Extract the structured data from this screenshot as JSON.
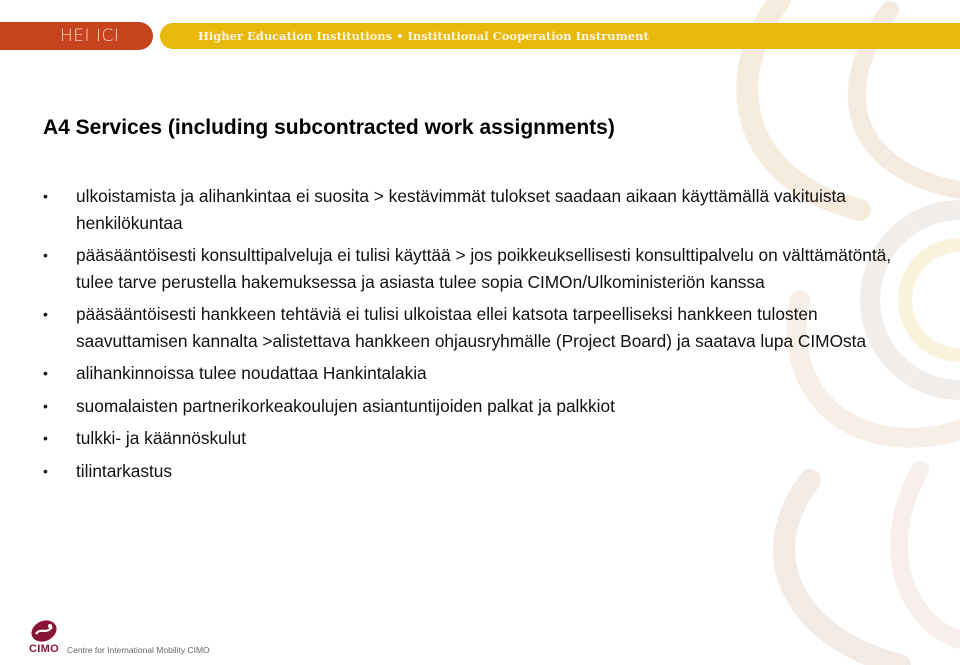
{
  "header": {
    "logo_text": "HEI ICI",
    "tagline": "Higher Education Institutions • Institutional Cooperation Instrument",
    "colors": {
      "logo_bg": "#c8441f",
      "tagline_bg": "#e8b80a"
    }
  },
  "slide": {
    "title": "A4 Services (including subcontracted work assignments)",
    "bullets": [
      {
        "text": "ulkoistamista ja alihankintaa ei suosita > kestävimmät tulokset saadaan aikaan käyttämällä vakituista henkilökuntaa"
      },
      {
        "text": "pääsääntöisesti konsulttipalveluja ei tulisi käyttää > jos poikkeuksellisesti konsulttipalvelu on välttämätöntä, tulee tarve perustella hakemuksessa ja asiasta tulee sopia CIMOn/Ulkoministeriön kanssa"
      },
      {
        "text": "pääsääntöisesti hankkeen tehtäviä ei tulisi ulkoistaa ellei katsota tarpeelliseksi hankkeen tulosten saavuttamisen kannalta >alistettava hankkeen ohjausryhmälle (Project Board) ja saatava lupa CIMOsta"
      },
      {
        "text": "alihankinnoissa tulee noudattaa Hankintalakia"
      },
      {
        "text": "suomalaisten partnerikorkeakoulujen asiantuntijoiden palkat ja palkkiot"
      },
      {
        "text": "tulkki- ja käännöskulut"
      },
      {
        "text": "tilintarkastus"
      }
    ],
    "bullet_glyph": "•"
  },
  "footer": {
    "logo_text": "CIMO",
    "org_name": "Centre for International Mobility CIMO",
    "brand_color": "#8b1538"
  }
}
